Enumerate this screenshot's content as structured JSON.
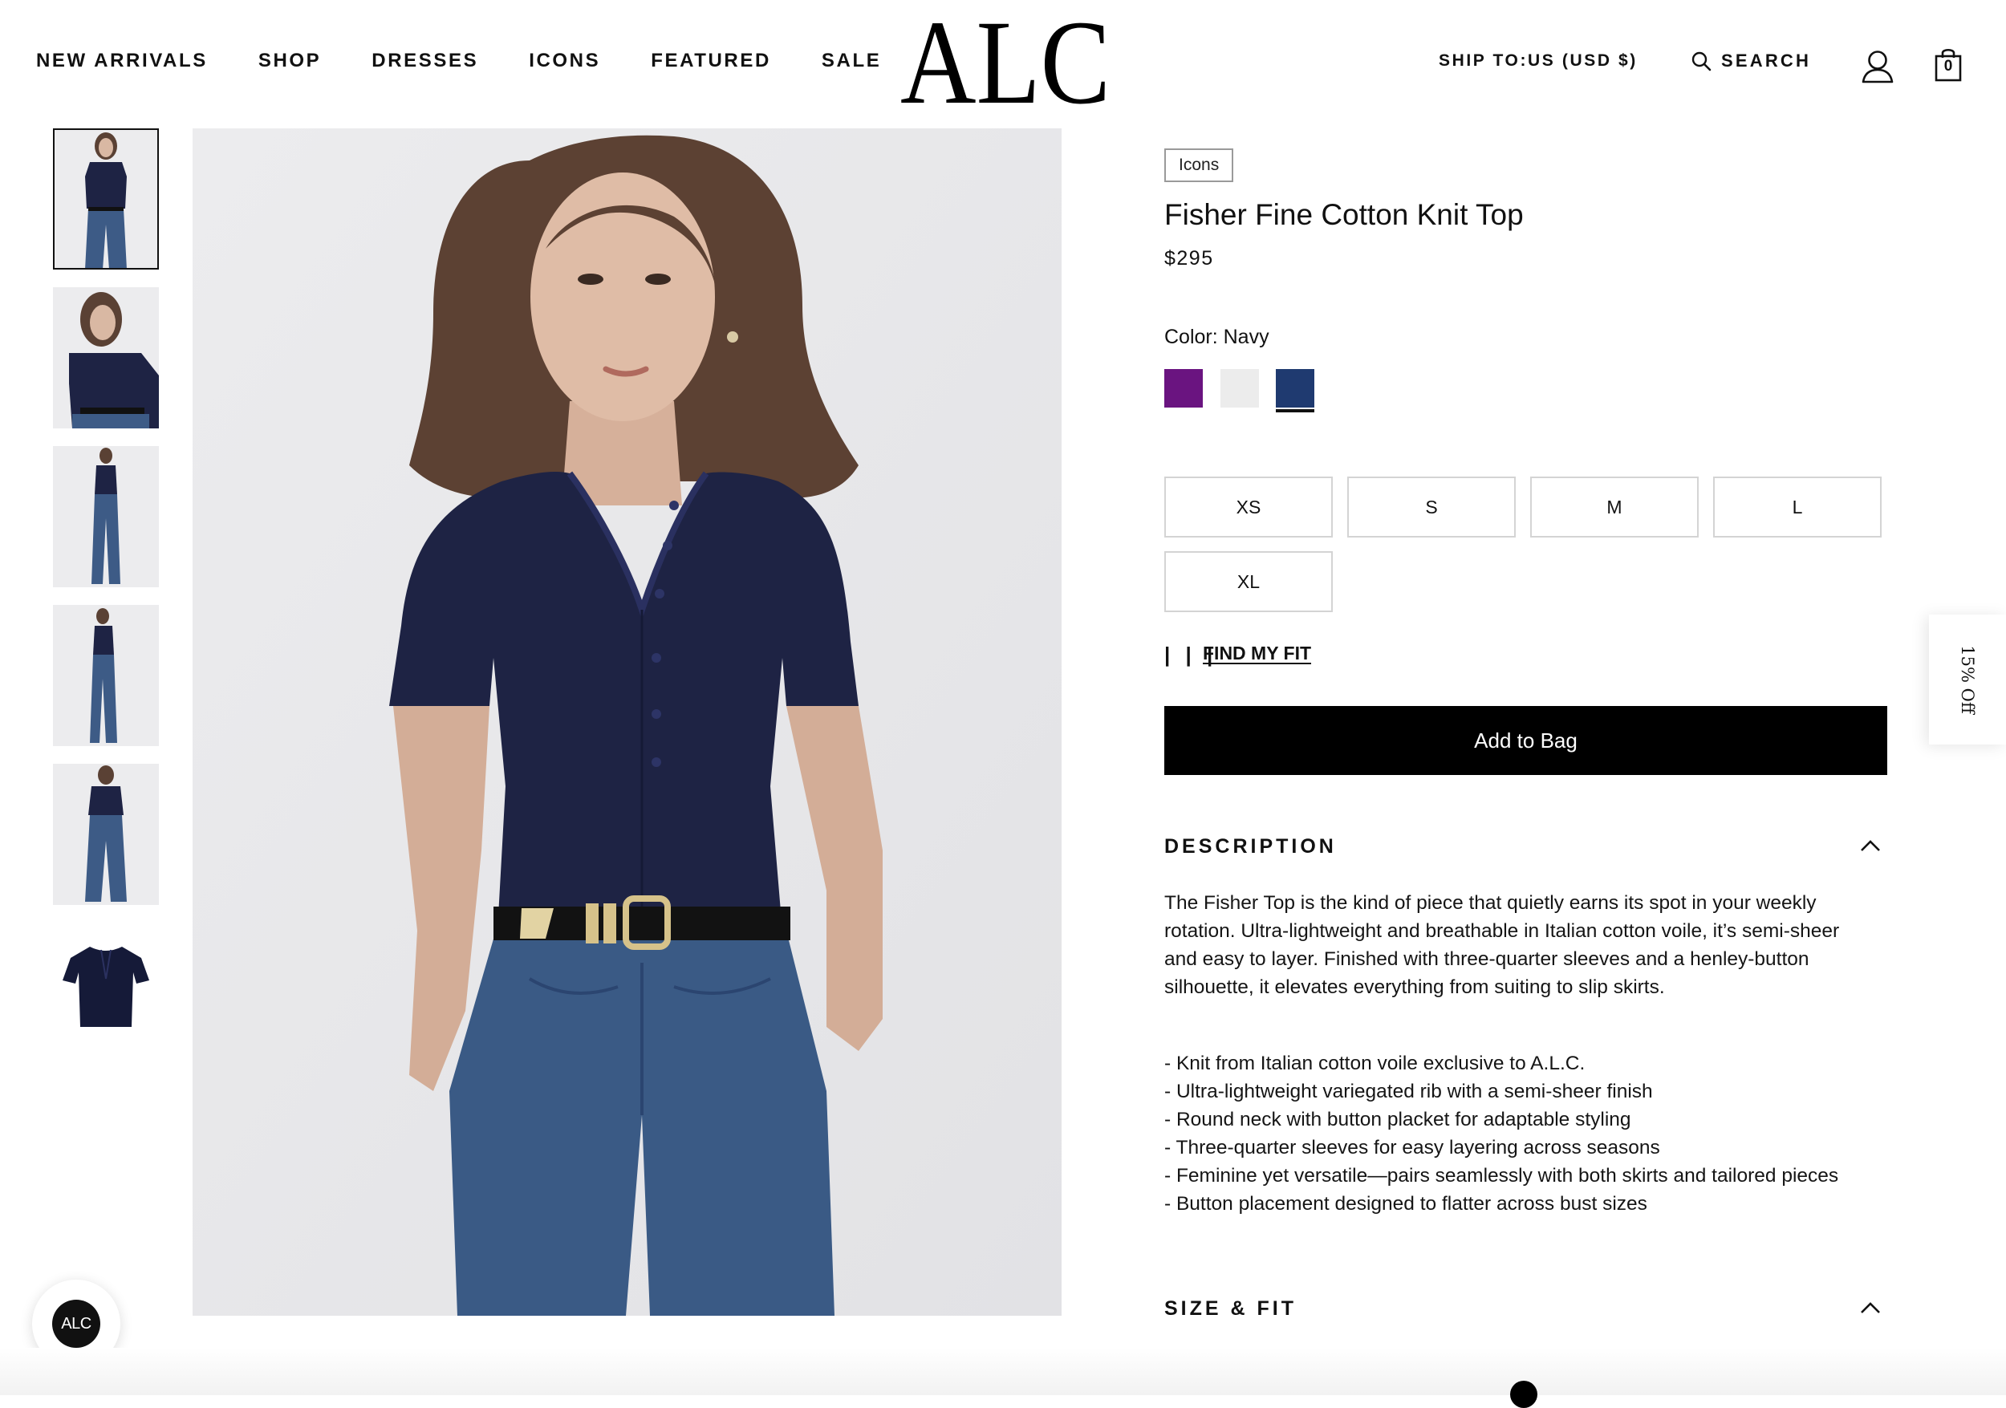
{
  "header": {
    "nav": [
      "NEW ARRIVALS",
      "SHOP",
      "DRESSES",
      "ICONS",
      "FEATURED",
      "SALE"
    ],
    "logo_text": "ALC",
    "ship_to": "SHIP TO:US (USD $)",
    "search_label": "SEARCH",
    "bag_count": "0",
    "icons": [
      "search-icon",
      "account-icon",
      "bag-icon"
    ]
  },
  "gallery": {
    "thumbnails": [
      "model-front",
      "model-closeup",
      "model-full-length",
      "model-side",
      "model-back",
      "product-flat"
    ],
    "active_index": 0
  },
  "product": {
    "tag": "Icons",
    "title": "Fisher Fine Cotton Knit Top",
    "price": "$295",
    "color_label": "Color: Navy",
    "swatches": [
      {
        "name": "purple",
        "color": "#6a1480"
      },
      {
        "name": "white",
        "color": "#ececec"
      },
      {
        "name": "navy",
        "color": "#1f3a70",
        "selected": true
      }
    ],
    "sizes": [
      "XS",
      "S",
      "M",
      "L",
      "XL"
    ],
    "fit_bars": "| | |",
    "find_my_fit": "FIND MY FIT",
    "add_to_bag": "Add to Bag",
    "description_heading": "DESCRIPTION",
    "description": "The Fisher Top is the kind of piece that quietly earns its spot in your weekly rotation. Ultra-lightweight and breathable in Italian cotton voile, it’s semi-sheer and easy to layer. Finished with three-quarter sleeves and a henley-button silhouette, it elevates everything from suiting to slip skirts.",
    "bullets": [
      "- Knit from Italian cotton voile exclusive to A.L.C.",
      "- Ultra-lightweight variegated rib with a semi-sheer finish",
      "- Round neck with button placket for adaptable styling",
      "- Three-quarter sleeves for easy layering across seasons",
      "- Feminine yet versatile—pairs seamlessly with both skirts and tailored pieces",
      "- Button placement designed to flatter across bust sizes"
    ],
    "size_fit_heading": "SIZE & FIT"
  },
  "promo": {
    "label": "15% Off"
  },
  "chat": {
    "label": "ALC"
  },
  "colors": {
    "accent": "#000000",
    "background": "#ffffff",
    "garment_navy": "#1c2142",
    "denim": "#3a5a85"
  }
}
